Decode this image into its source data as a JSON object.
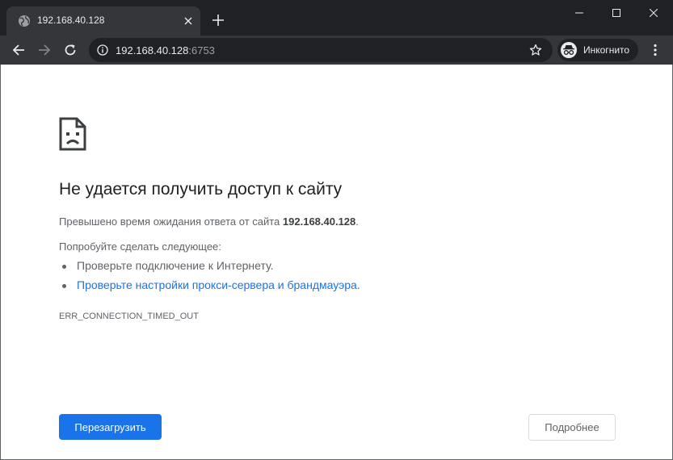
{
  "tab": {
    "title": "192.168.40.128",
    "favicon": "globe-icon"
  },
  "window_controls": {
    "minimize": "minimize-icon",
    "maximize": "maximize-icon",
    "close": "close-icon"
  },
  "toolbar": {
    "url_host": "192.168.40.128",
    "url_port": ":6753",
    "incognito_label": "Инкогнито"
  },
  "error": {
    "title": "Не удается получить доступ к сайту",
    "description_prefix": "Превышено время ожидания ответа от сайта ",
    "description_host": "192.168.40.128",
    "description_suffix": ".",
    "try_label": "Попробуйте сделать следующее:",
    "suggestions": [
      "Проверьте подключение к Интернету.",
      "Проверьте настройки прокси-сервера и брандмауэра"
    ],
    "suggestion_2_suffix": ".",
    "code": "ERR_CONNECTION_TIMED_OUT"
  },
  "buttons": {
    "reload": "Перезагрузить",
    "details": "Подробнее"
  },
  "colors": {
    "frame": "#202124",
    "toolbar": "#35363a",
    "accent": "#1a73e8",
    "text_secondary": "#5f6368"
  }
}
